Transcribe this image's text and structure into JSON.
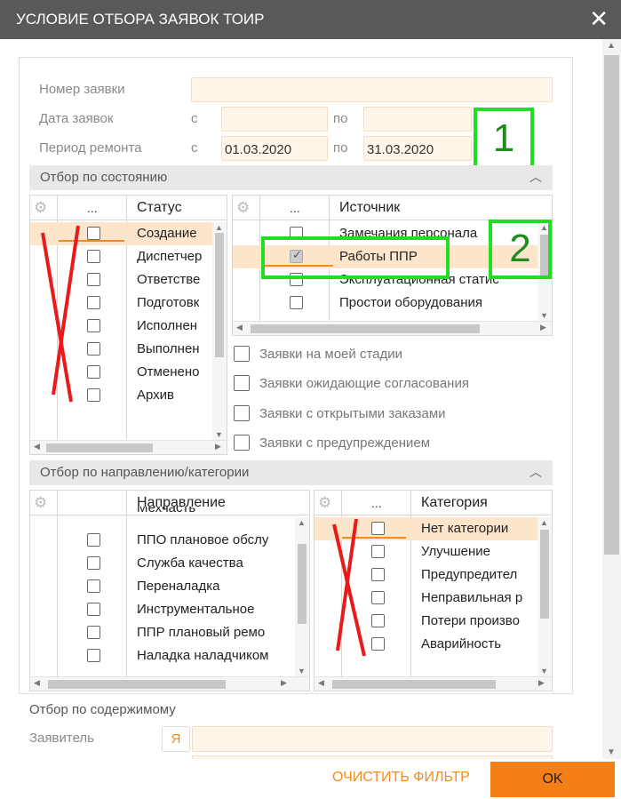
{
  "window": {
    "title": "УСЛОВИЕ ОТБОРА ЗАЯВОК ТОИР",
    "close_icon": "close-icon"
  },
  "fields": {
    "request_number_label": "Номер заявки",
    "request_date_label": "Дата заявок",
    "repair_period_label": "Период ремонта",
    "from_label": "с",
    "to_label": "по",
    "repair_from": "01.03.2020",
    "repair_to": "31.03.2020"
  },
  "section_state": {
    "title": "Отбор по состоянию"
  },
  "status_grid": {
    "dots": "...",
    "header": "Статус",
    "rows": [
      "Создание",
      "Диспетчер",
      "Ответстве",
      "Подготовк",
      "Исполнен",
      "Выполнен",
      "Отменено",
      "Архив"
    ]
  },
  "source_grid": {
    "dots": "...",
    "header": "Источник",
    "rows": [
      "Замечания персонала",
      "Работы ППР",
      "Эксплуатационная статис",
      "Простои оборудования"
    ]
  },
  "checkboxes": [
    "Заявки на моей стадии",
    "Заявки ожидающие согласования",
    "Заявки с открытыми заказами",
    "Заявки с предупреждением"
  ],
  "section_direction": {
    "title": "Отбор по направлению/категории"
  },
  "direction_grid": {
    "dots": "...",
    "header": "Направление",
    "rows": [
      "Мехчасть",
      "ППО плановое обслу",
      "Служба качества",
      "Переналадка",
      "Инструментальное",
      "ППР плановый ремо",
      "Наладка наладчиком"
    ]
  },
  "category_grid": {
    "dots": "...",
    "header": "Категория",
    "rows": [
      "Нет категории",
      "Улучшение",
      "Предупредител",
      "Неправильная р",
      "Потери произво",
      "Аварийность"
    ]
  },
  "content": {
    "title": "Отбор по содержимому",
    "applicant_label": "Заявитель",
    "me_button": "Я"
  },
  "annotations": {
    "box1": "1",
    "box2": "2"
  },
  "footer": {
    "clear": "ОЧИСТИТЬ ФИЛЬТР",
    "ok": "OK"
  },
  "colors": {
    "accent": "#f57f17",
    "title_bar": "#595959",
    "input_bg": "#fff5e8",
    "selected_row": "#fde5cc",
    "annotation_green": "#22dd22",
    "annotation_red": "#e81a1a"
  }
}
